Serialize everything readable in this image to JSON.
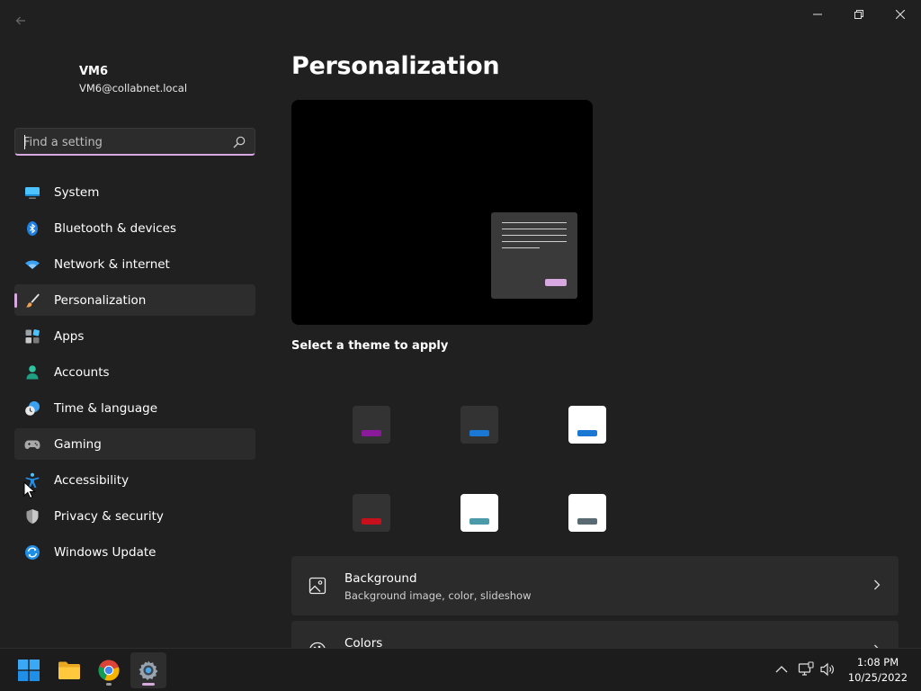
{
  "window": {
    "title_controls": [
      "minimize",
      "maximize",
      "close"
    ]
  },
  "profile": {
    "name": "VM6",
    "email": "VM6@collabnet.local"
  },
  "search": {
    "placeholder": "Find a setting"
  },
  "sidebar": {
    "items": [
      {
        "label": "System",
        "icon": "monitor-icon",
        "selected": false
      },
      {
        "label": "Bluetooth & devices",
        "icon": "bluetooth-icon",
        "selected": false
      },
      {
        "label": "Network & internet",
        "icon": "wifi-icon",
        "selected": false
      },
      {
        "label": "Personalization",
        "icon": "paintbrush-icon",
        "selected": true
      },
      {
        "label": "Apps",
        "icon": "apps-icon",
        "selected": false
      },
      {
        "label": "Accounts",
        "icon": "person-icon",
        "selected": false
      },
      {
        "label": "Time & language",
        "icon": "clock-globe-icon",
        "selected": false
      },
      {
        "label": "Gaming",
        "icon": "gamepad-icon",
        "selected": false,
        "hover": true
      },
      {
        "label": "Accessibility",
        "icon": "accessibility-icon",
        "selected": false
      },
      {
        "label": "Privacy & security",
        "icon": "shield-icon",
        "selected": false
      },
      {
        "label": "Windows Update",
        "icon": "update-icon",
        "selected": false
      }
    ]
  },
  "main": {
    "title": "Personalization",
    "theme_section_label": "Select a theme to apply",
    "themes": [
      {
        "background": "#333333",
        "bar": "#8a1a9a"
      },
      {
        "background": "#333333",
        "bar": "#1a78d4"
      },
      {
        "background": "#ffffff",
        "bar": "#1a78d4"
      },
      {
        "background": "#333333",
        "bar": "#c8101c"
      },
      {
        "background": "#ffffff",
        "bar": "#4a9aaa"
      },
      {
        "background": "#ffffff",
        "bar": "#5a6a72"
      }
    ],
    "cards": [
      {
        "title": "Background",
        "subtitle": "Background image, color, slideshow",
        "icon": "image-icon"
      },
      {
        "title": "Colors",
        "subtitle": "",
        "icon": "palette-icon"
      }
    ]
  },
  "taskbar": {
    "apps": [
      "start-icon",
      "file-explorer-icon",
      "chrome-icon",
      "settings-icon"
    ],
    "time": "1:08 PM",
    "date": "10/25/2022"
  },
  "colors": {
    "accent": "#d8a8e0",
    "background": "#202020",
    "card": "#2b2b2b"
  }
}
